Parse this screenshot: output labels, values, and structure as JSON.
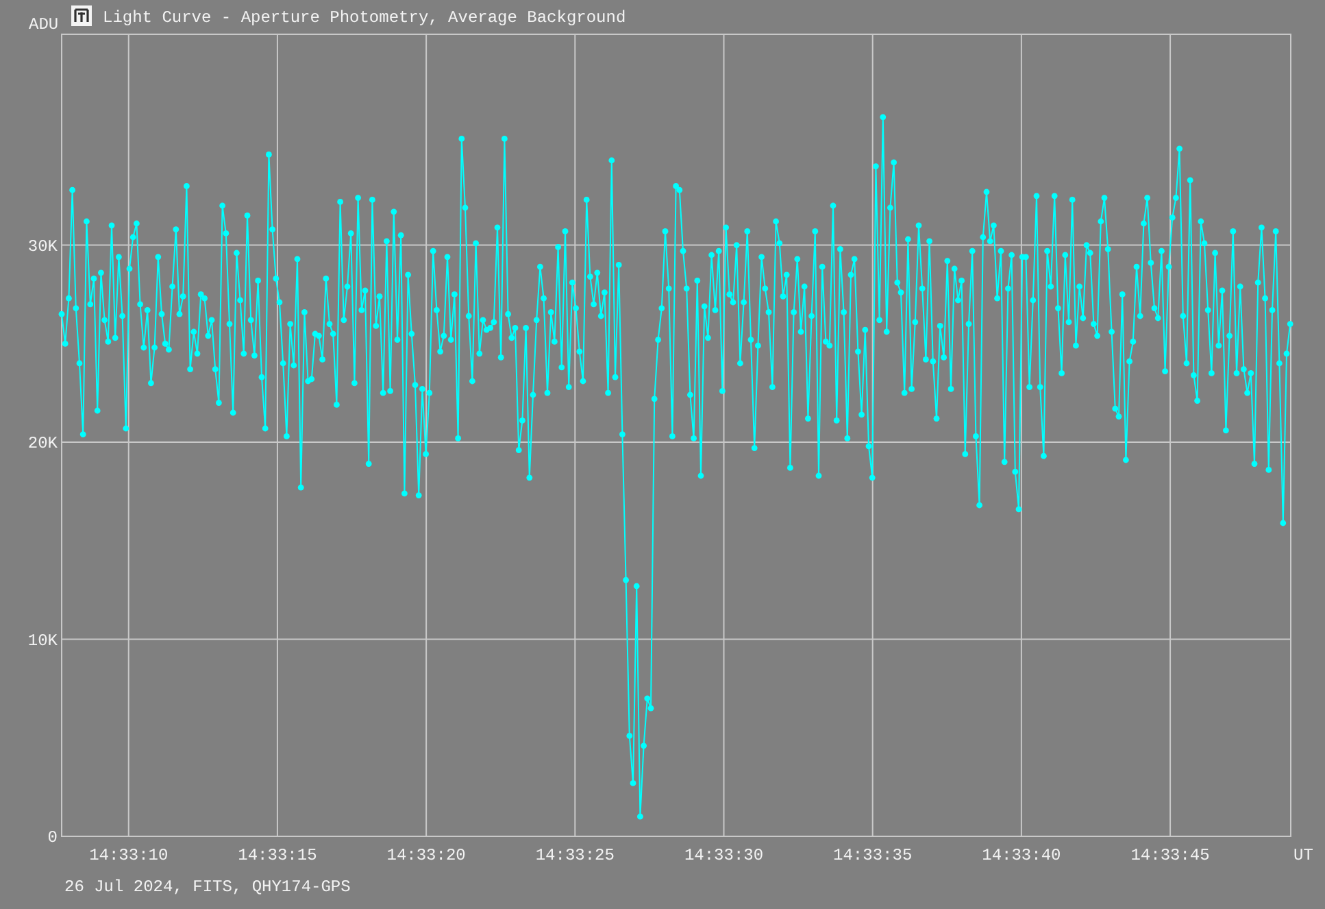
{
  "window": {
    "title": "Light Curve - Aperture Photometry, Average Background"
  },
  "chart_data": {
    "type": "line",
    "ylabel": "ADU",
    "xlabel": "UT",
    "xlim": [
      52387.75,
      52429.05
    ],
    "ylim": [
      0,
      40.7
    ],
    "grid": true,
    "x": [
      52387.75,
      52387.87,
      52387.99,
      52388.11,
      52388.23,
      52388.35,
      52388.47,
      52388.59,
      52388.71,
      52388.83,
      52388.95,
      52389.07,
      52389.19,
      52389.31,
      52389.43,
      52389.55,
      52389.67,
      52389.79,
      52389.91,
      52390.03,
      52390.15,
      52390.27,
      52390.39,
      52390.51,
      52390.63,
      52390.75,
      52390.87,
      52390.99,
      52391.11,
      52391.23,
      52391.35,
      52391.47,
      52391.59,
      52391.71,
      52391.83,
      52391.95,
      52392.07,
      52392.19,
      52392.31,
      52392.43,
      52392.55,
      52392.67,
      52392.79,
      52392.91,
      52393.03,
      52393.15,
      52393.27,
      52393.39,
      52393.51,
      52393.63,
      52393.75,
      52393.87,
      52393.99,
      52394.11,
      52394.23,
      52394.35,
      52394.47,
      52394.59,
      52394.71,
      52394.83,
      52394.95,
      52395.07,
      52395.19,
      52395.31,
      52395.43,
      52395.55,
      52395.67,
      52395.79,
      52395.91,
      52396.03,
      52396.15,
      52396.27,
      52396.39,
      52396.51,
      52396.63,
      52396.75,
      52396.87,
      52396.99,
      52397.11,
      52397.23,
      52397.35,
      52397.47,
      52397.59,
      52397.71,
      52397.83,
      52397.95,
      52398.07,
      52398.19,
      52398.31,
      52398.43,
      52398.55,
      52398.67,
      52398.79,
      52398.91,
      52399.03,
      52399.15,
      52399.27,
      52399.39,
      52399.51,
      52399.63,
      52399.75,
      52399.87,
      52399.99,
      52400.11,
      52400.23,
      52400.35,
      52400.47,
      52400.59,
      52400.71,
      52400.83,
      52400.95,
      52401.07,
      52401.19,
      52401.31,
      52401.43,
      52401.55,
      52401.67,
      52401.79,
      52401.91,
      52402.03,
      52402.15,
      52402.27,
      52402.39,
      52402.51,
      52402.63,
      52402.75,
      52402.87,
      52402.99,
      52403.11,
      52403.23,
      52403.35,
      52403.47,
      52403.59,
      52403.71,
      52403.83,
      52403.95,
      52404.07,
      52404.19,
      52404.31,
      52404.43,
      52404.55,
      52404.67,
      52404.79,
      52404.91,
      52405.03,
      52405.15,
      52405.27,
      52405.39,
      52405.51,
      52405.63,
      52405.75,
      52405.87,
      52405.99,
      52406.11,
      52406.23,
      52406.35,
      52406.47,
      52406.59,
      52406.71,
      52406.83,
      52406.95,
      52407.07,
      52407.19,
      52407.31,
      52407.43,
      52407.55,
      52407.67,
      52407.79,
      52407.91,
      52408.03,
      52408.15,
      52408.27,
      52408.39,
      52408.51,
      52408.63,
      52408.75,
      52408.87,
      52408.99,
      52409.11,
      52409.23,
      52409.35,
      52409.47,
      52409.59,
      52409.71,
      52409.83,
      52409.95,
      52410.07,
      52410.19,
      52410.31,
      52410.43,
      52410.55,
      52410.67,
      52410.79,
      52410.91,
      52411.03,
      52411.15,
      52411.27,
      52411.39,
      52411.51,
      52411.63,
      52411.75,
      52411.87,
      52411.99,
      52412.11,
      52412.23,
      52412.35,
      52412.47,
      52412.59,
      52412.71,
      52412.83,
      52412.95,
      52413.07,
      52413.19,
      52413.31,
      52413.43,
      52413.55,
      52413.67,
      52413.79,
      52413.91,
      52414.03,
      52414.15,
      52414.27,
      52414.39,
      52414.51,
      52414.63,
      52414.75,
      52414.87,
      52414.99,
      52415.11,
      52415.23,
      52415.35,
      52415.47,
      52415.59,
      52415.71,
      52415.83,
      52415.95,
      52416.07,
      52416.19,
      52416.31,
      52416.43,
      52416.55,
      52416.67,
      52416.79,
      52416.91,
      52417.03,
      52417.15,
      52417.27,
      52417.39,
      52417.51,
      52417.63,
      52417.75,
      52417.87,
      52417.99,
      52418.11,
      52418.23,
      52418.35,
      52418.47,
      52418.59,
      52418.71,
      52418.83,
      52418.95,
      52419.07,
      52419.19,
      52419.31,
      52419.43,
      52419.55,
      52419.67,
      52419.79,
      52419.91,
      52420.03,
      52420.15,
      52420.27,
      52420.39,
      52420.51,
      52420.63,
      52420.75,
      52420.87,
      52420.99,
      52421.11,
      52421.23,
      52421.35,
      52421.47,
      52421.59,
      52421.71,
      52421.83,
      52421.95,
      52422.07,
      52422.19,
      52422.31,
      52422.43,
      52422.55,
      52422.67,
      52422.79,
      52422.91,
      52423.03,
      52423.15,
      52423.27,
      52423.39,
      52423.51,
      52423.63,
      52423.75,
      52423.87,
      52423.99,
      52424.11,
      52424.23,
      52424.35,
      52424.47,
      52424.59,
      52424.71,
      52424.83,
      52424.95,
      52425.07,
      52425.19,
      52425.31,
      52425.43,
      52425.55,
      52425.67,
      52425.79,
      52425.91,
      52426.03,
      52426.15,
      52426.27,
      52426.39,
      52426.51,
      52426.63,
      52426.75,
      52426.87,
      52426.99,
      52427.11,
      52427.23,
      52427.35,
      52427.47,
      52427.59,
      52427.71,
      52427.83,
      52427.95,
      52428.07,
      52428.19,
      52428.31,
      52428.43,
      52428.55,
      52428.67,
      52428.79,
      52428.91,
      52429.03
    ],
    "xticks": [
      {
        "value": 52390,
        "label": "14:33:10"
      },
      {
        "value": 52395,
        "label": "14:33:15"
      },
      {
        "value": 52400,
        "label": "14:33:20"
      },
      {
        "value": 52405,
        "label": "14:33:25"
      },
      {
        "value": 52410,
        "label": "14:33:30"
      },
      {
        "value": 52415,
        "label": "14:33:35"
      },
      {
        "value": 52420,
        "label": "14:33:40"
      },
      {
        "value": 52425,
        "label": "14:33:45"
      }
    ],
    "yticks": [
      {
        "value": 0,
        "label": "0"
      },
      {
        "value": 10,
        "label": "10K"
      },
      {
        "value": 20,
        "label": "20K"
      },
      {
        "value": 30,
        "label": "30K"
      }
    ],
    "series": [
      {
        "color": "#00ffff",
        "marker": "circle",
        "values": [
          26.5,
          25,
          27.3,
          32.8,
          26.8,
          24,
          20.4,
          31.2,
          27,
          28.3,
          21.6,
          28.6,
          26.2,
          25.1,
          31,
          25.3,
          29.4,
          26.4,
          20.7,
          28.8,
          30.4,
          31.1,
          27,
          24.8,
          26.7,
          23,
          24.8,
          29.4,
          26.5,
          25,
          24.7,
          27.9,
          30.8,
          26.5,
          27.4,
          33,
          23.7,
          25.6,
          24.5,
          27.5,
          27.3,
          25.4,
          26.2,
          23.7,
          22,
          32,
          30.6,
          26,
          21.5,
          29.6,
          27.2,
          24.5,
          31.5,
          26.2,
          24.4,
          28.2,
          23.3,
          20.7,
          34.6,
          30.8,
          28.3,
          27.1,
          24,
          20.3,
          26,
          23.9,
          29.3,
          17.7,
          26.6,
          23.1,
          23.2,
          25.5,
          25.4,
          24.2,
          28.3,
          26,
          25.5,
          21.9,
          32.2,
          26.2,
          27.9,
          30.6,
          23,
          32.4,
          26.7,
          27.7,
          18.9,
          32.3,
          25.9,
          27.4,
          22.5,
          30.2,
          22.6,
          31.7,
          25.2,
          30.5,
          17.4,
          28.5,
          25.5,
          22.9,
          17.3,
          22.7,
          19.4,
          22.5,
          29.7,
          26.7,
          24.6,
          25.4,
          29.4,
          25.2,
          27.5,
          20.2,
          35.4,
          31.9,
          26.4,
          23.1,
          30.1,
          24.5,
          26.2,
          25.7,
          25.8,
          26.1,
          30.9,
          24.3,
          35.4,
          26.5,
          25.3,
          25.8,
          19.6,
          21.1,
          25.8,
          18.2,
          22.4,
          26.2,
          28.9,
          27.3,
          22.5,
          26.6,
          25.1,
          29.9,
          23.8,
          30.7,
          22.8,
          28.1,
          26.8,
          24.6,
          23.1,
          32.3,
          28.4,
          27,
          28.6,
          26.4,
          27.6,
          22.5,
          34.3,
          23.3,
          29,
          20.4,
          13,
          5.1,
          2.7,
          12.7,
          1,
          4.6,
          7,
          6.5,
          22.2,
          25.2,
          26.8,
          30.7,
          27.8,
          20.3,
          33,
          32.8,
          29.7,
          27.8,
          22.4,
          20.2,
          28.2,
          18.3,
          26.9,
          25.3,
          29.5,
          26.7,
          29.7,
          22.6,
          30.9,
          27.5,
          27.1,
          30,
          24,
          27.1,
          30.7,
          25.2,
          19.7,
          24.9,
          29.4,
          27.8,
          26.6,
          22.8,
          31.2,
          30.1,
          27.4,
          28.5,
          18.7,
          26.6,
          29.3,
          25.6,
          27.9,
          21.2,
          26.4,
          30.7,
          18.3,
          28.9,
          25.1,
          24.9,
          32,
          21.1,
          29.8,
          26.6,
          20.2,
          28.5,
          29.3,
          24.6,
          21.4,
          25.7,
          19.8,
          18.2,
          34,
          26.2,
          36.5,
          25.6,
          31.9,
          34.2,
          28.1,
          27.6,
          22.5,
          30.3,
          22.7,
          26.1,
          31,
          27.8,
          24.2,
          30.2,
          24.1,
          21.2,
          25.9,
          24.3,
          29.2,
          22.7,
          28.8,
          27.2,
          28.2,
          19.4,
          26,
          29.7,
          20.3,
          16.8,
          30.4,
          32.7,
          30.2,
          31,
          27.3,
          29.7,
          19,
          27.8,
          29.5,
          18.5,
          16.6,
          29.4,
          29.4,
          22.8,
          27.2,
          32.5,
          22.8,
          19.3,
          29.7,
          27.9,
          32.5,
          26.8,
          23.5,
          29.5,
          26.1,
          32.3,
          24.9,
          27.9,
          26.3,
          30,
          29.6,
          26,
          25.4,
          31.2,
          32.4,
          29.8,
          25.6,
          21.7,
          21.3,
          27.5,
          19.1,
          24.1,
          25.1,
          28.9,
          26.4,
          31.1,
          32.4,
          29.1,
          26.8,
          26.3,
          29.7,
          23.6,
          28.9,
          31.4,
          32.4,
          34.9,
          26.4,
          24,
          33.3,
          23.4,
          22.1,
          31.2,
          30.1,
          26.7,
          23.5,
          29.6,
          24.9,
          27.7,
          20.6,
          25.4,
          30.7,
          23.5,
          27.9,
          23.7,
          22.5,
          23.5,
          18.9,
          28.1,
          30.9,
          27.3,
          18.6,
          26.7,
          30.7,
          24,
          15.9,
          24.5,
          26
        ]
      }
    ]
  },
  "footer": "26 Jul 2024, FITS, QHY174-GPS"
}
